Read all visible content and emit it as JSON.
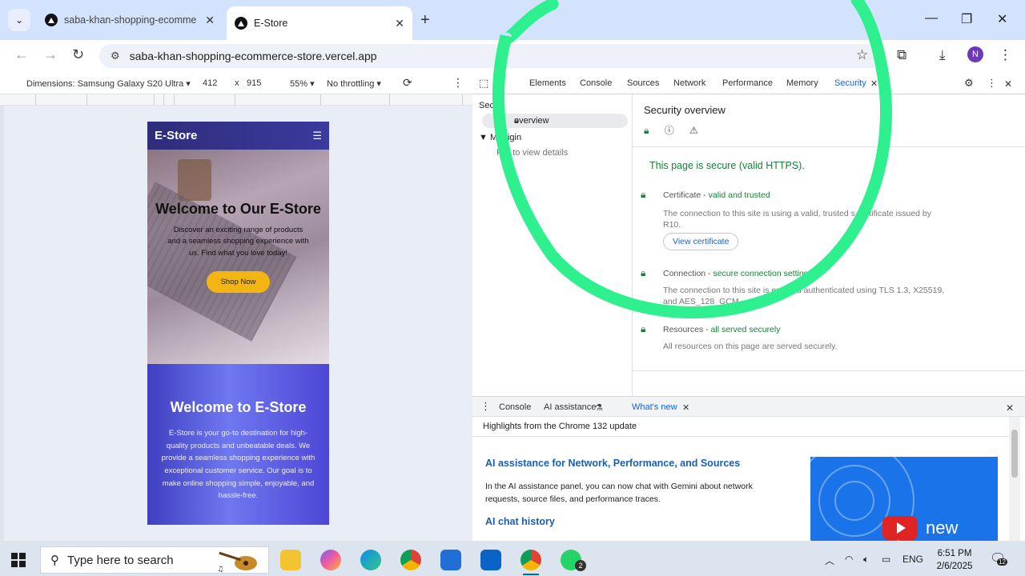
{
  "browser": {
    "tabs": [
      {
        "title": "saba-khan-shopping-ecommerce",
        "active": false
      },
      {
        "title": "E-Store",
        "active": true
      }
    ],
    "new_tab": "+",
    "url": "saba-khan-shopping-ecommerce-store.vercel.app",
    "profile_initial": "N"
  },
  "device_toolbar": {
    "device": "Dimensions: Samsung Galaxy S20 Ultra",
    "width": "412",
    "times": "x",
    "height": "915",
    "zoom": "55%",
    "throttling": "No throttling"
  },
  "site": {
    "brand": "E-Store",
    "hero_title": "Welcome to Our E-Store",
    "hero_text": "Discover an exciting range of products and a seamless shopping experience with us. Find what you love today!",
    "hero_button": "Shop Now",
    "about_title": "Welcome to E-Store",
    "about_text": "E-Store is your go-to destination for high-quality products and unbeatable deals. We provide a seamless shopping experience with exceptional customer service. Our goal is to make online shopping simple, enjoyable, and hassle-free."
  },
  "devtools": {
    "tabs": [
      "Elements",
      "Console",
      "Sources",
      "Network",
      "Performance",
      "Memory",
      "Security"
    ],
    "active_tab": "Security",
    "left_panel": {
      "heading": "Secur",
      "overview": "overview",
      "main_origin": "Ma   rigin",
      "reload": "R     d to view details"
    },
    "overview": {
      "title": "Security overview",
      "status": "This page is secure (valid HTTPS).",
      "certificate_label": "Certificate - ",
      "certificate_status": "valid and trusted",
      "certificate_text": "The connection to this site is using a valid, trusted s     certificate issued by R10.",
      "view_certificate": "View certificate",
      "connection_label": "Connection - ",
      "connection_status": "secure connection setting",
      "connection_text": "The connection to this site is enc        and authenticated using TLS 1.3, X25519, and AES_128_GCM",
      "resources_label": "Resources - ",
      "resources_status": "all served securely",
      "resources_text": "All resources on this page are served securely."
    },
    "drawer": {
      "tabs": [
        "Console",
        "AI assistance",
        "What's new"
      ],
      "active_tab": "What's new",
      "highlight": "Highlights from the Chrome 132 update",
      "heading1": "AI assistance for Network, Performance, and Sources",
      "text1": "In the AI assistance panel, you can now chat with Gemini about network requests, source files, and performance traces.",
      "heading2": "AI chat history",
      "promo_text": "new"
    }
  },
  "taskbar": {
    "search_placeholder": "Type here to search",
    "language": "ENG",
    "time": "6:51 PM",
    "date": "2/6/2025",
    "notifications": "12",
    "whatsapp_badge": "2"
  },
  "colors": {
    "annotation": "#2ef08f",
    "secure_green": "#188038",
    "link_blue": "#1a62d6",
    "shop_button": "#f2b511"
  }
}
